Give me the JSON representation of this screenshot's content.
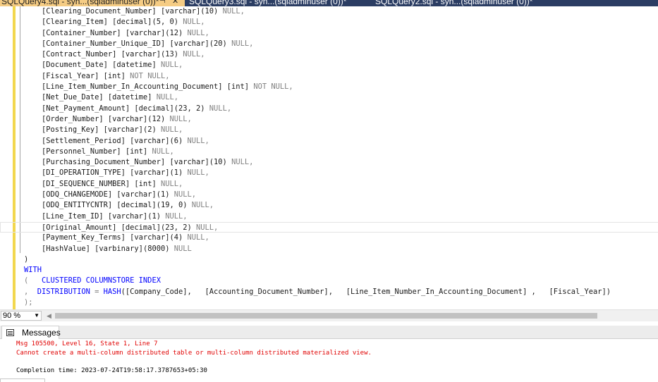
{
  "tabs": [
    {
      "label": "SQLQuery4.sql - syn...(sqladminuser (0))*",
      "active": true
    },
    {
      "label": "SQLQuery3.sql - syn...(sqladminuser (0))*",
      "active": false
    },
    {
      "label": "SQLQuery2.sql - syn...(sqladminuser (0))*",
      "active": false
    }
  ],
  "tab_icons": {
    "pin": "pin-icon",
    "close": "close-icon"
  },
  "editor": {
    "columns": [
      {
        "name": "[Clearing_Document_Number]",
        "type": "[varchar]",
        "size": "(10)",
        "null": "NULL,"
      },
      {
        "name": "[Clearing_Item]",
        "type": "[decimal]",
        "size": "(5, 0)",
        "null": "NULL,"
      },
      {
        "name": "[Container_Number]",
        "type": "[varchar]",
        "size": "(12)",
        "null": "NULL,"
      },
      {
        "name": "[Container_Number_Unique_ID]",
        "type": "[varchar]",
        "size": "(20)",
        "null": "NULL,"
      },
      {
        "name": "[Contract_Number]",
        "type": "[varchar]",
        "size": "(13)",
        "null": "NULL,"
      },
      {
        "name": "[Document_Date]",
        "type": "[datetime]",
        "size": "",
        "null": "NULL,"
      },
      {
        "name": "[Fiscal_Year]",
        "type": "[int]",
        "size": "",
        "null": "NOT NULL,"
      },
      {
        "name": "[Line_Item_Number_In_Accounting_Document]",
        "type": "[int]",
        "size": "",
        "null": "NOT NULL,"
      },
      {
        "name": "[Net_Due_Date]",
        "type": "[datetime]",
        "size": "",
        "null": "NULL,"
      },
      {
        "name": "[Net_Payment_Amount]",
        "type": "[decimal]",
        "size": "(23, 2)",
        "null": "NULL,"
      },
      {
        "name": "[Order_Number]",
        "type": "[varchar]",
        "size": "(12)",
        "null": "NULL,"
      },
      {
        "name": "[Posting_Key]",
        "type": "[varchar]",
        "size": "(2)",
        "null": "NULL,"
      },
      {
        "name": "[Settlement_Period]",
        "type": "[varchar]",
        "size": "(6)",
        "null": "NULL,"
      },
      {
        "name": "[Personnel_Number]",
        "type": "[int]",
        "size": "",
        "null": "NULL,"
      },
      {
        "name": "[Purchasing_Document_Number]",
        "type": "[varchar]",
        "size": "(10)",
        "null": "NULL,"
      },
      {
        "name": "[DI_OPERATION_TYPE]",
        "type": "[varchar]",
        "size": "(1)",
        "null": "NULL,"
      },
      {
        "name": "[DI_SEQUENCE_NUMBER]",
        "type": "[int]",
        "size": "",
        "null": "NULL,"
      },
      {
        "name": "[ODQ_CHANGEMODE]",
        "type": "[varchar]",
        "size": "(1)",
        "null": "NULL,"
      },
      {
        "name": "[ODQ_ENTITYCNTR]",
        "type": "[decimal]",
        "size": "(19, 0)",
        "null": "NULL,"
      },
      {
        "name": "[Line_Item_ID]",
        "type": "[varchar]",
        "size": "(1)",
        "null": "NULL,"
      },
      {
        "name": "[Original_Amount]",
        "type": "[decimal]",
        "size": "(23, 2)",
        "null": "NULL,"
      },
      {
        "name": "[Payment_Key_Terms]",
        "type": "[varchar]",
        "size": "(4)",
        "null": "NULL,"
      },
      {
        "name": "[HashValue]",
        "type": "[varbinary]",
        "size": "(8000)",
        "null": "NULL"
      }
    ],
    "current_line_index": 20,
    "close_paren": ")",
    "with_kw": "WITH",
    "clustered_open": "(",
    "clustered_kw": "CLUSTERED COLUMNSTORE INDEX",
    "dist_comma": ",",
    "dist_kw": "DISTRIBUTION",
    "dist_eq": " = ",
    "dist_hash": "HASH",
    "dist_args": "([Company_Code],   [Accounting_Document_Number],   [Line_Item_Number_In_Accounting_Document] ,   [Fiscal_Year])",
    "end": ");"
  },
  "zoom": {
    "value": "90 %"
  },
  "results": {
    "tab_label": "Messages",
    "error_line1": "Msg 105500, Level 16, State 1, Line 7",
    "error_line2": "Cannot create a multi-column distributed table or multi-column distributed materialized view.",
    "completion": "Completion time: 2023-07-24T19:58:17.3787653+05:30"
  },
  "colors": {
    "keyword": "#0000ff",
    "null_gray": "#808080",
    "error": "#e00000",
    "tab_active": "#f5cc84",
    "tab_strip": "#2b3d63"
  }
}
